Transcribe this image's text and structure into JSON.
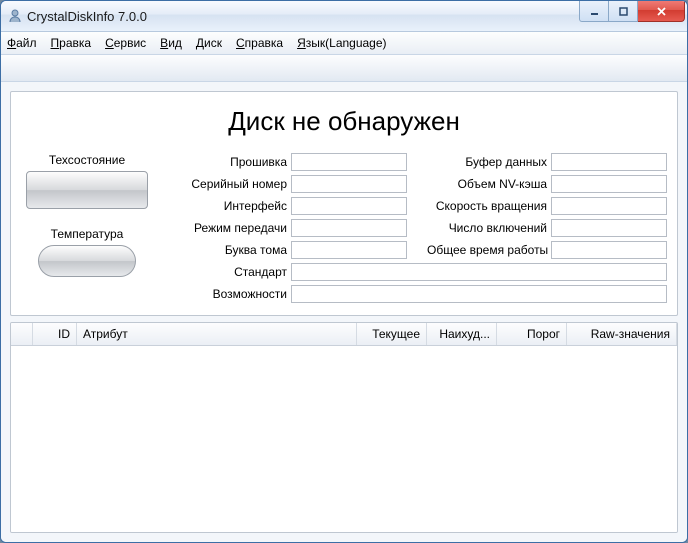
{
  "window": {
    "title": "CrystalDiskInfo 7.0.0"
  },
  "menu": {
    "file": {
      "accel": "Ф",
      "rest": "айл"
    },
    "edit": {
      "accel": "П",
      "rest": "равка"
    },
    "service": {
      "accel": "С",
      "rest": "ервис"
    },
    "view": {
      "accel": "В",
      "rest": "ид"
    },
    "disk": {
      "accel": "Д",
      "rest": "иск"
    },
    "help": {
      "accel": "С",
      "rest": "правка"
    },
    "lang": {
      "accel": "Я",
      "rest": "зык(Language)"
    }
  },
  "main": {
    "heading": "Диск не обнаружен",
    "status": {
      "health_label": "Техсостояние",
      "temp_label": "Температура"
    },
    "fields": {
      "firmware_label": "Прошивка",
      "serial_label": "Серийный номер",
      "interface_label": "Интерфейс",
      "transfer_label": "Режим передачи",
      "drive_letter_label": "Буква тома",
      "buffer_label": "Буфер данных",
      "nvcache_label": "Объем NV-кэша",
      "rpm_label": "Скорость вращения",
      "poweron_count_label": "Число включений",
      "poweron_hours_label": "Общее время работы",
      "standard_label": "Стандарт",
      "features_label": "Возможности",
      "firmware_value": "",
      "serial_value": "",
      "interface_value": "",
      "transfer_value": "",
      "drive_letter_value": "",
      "buffer_value": "",
      "nvcache_value": "",
      "rpm_value": "",
      "poweron_count_value": "",
      "poweron_hours_value": "",
      "standard_value": "",
      "features_value": ""
    }
  },
  "table": {
    "columns": {
      "id": "ID",
      "attr": "Атрибут",
      "current": "Текущее",
      "worst": "Наихуд...",
      "threshold": "Порог",
      "raw": "Raw-значения"
    },
    "rows": []
  }
}
